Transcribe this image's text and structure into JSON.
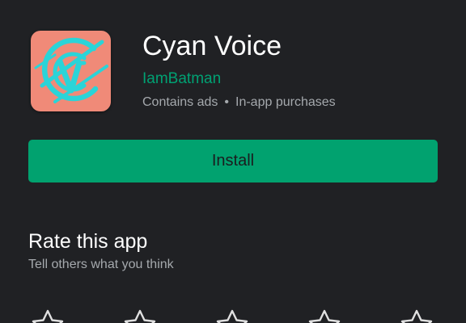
{
  "app": {
    "title": "Cyan Voice",
    "developer": "IamBatman",
    "meta_ads": "Contains ads",
    "meta_separator": "•",
    "meta_purchases": "In-app purchases",
    "icon": {
      "name": "cyan-voice-logo-icon",
      "background_color": "#f08a78",
      "foreground_color": "#2ad4d8",
      "letter": "V"
    }
  },
  "actions": {
    "install_label": "Install",
    "install_color": "#01a26f"
  },
  "rating": {
    "heading": "Rate this app",
    "subtitle": "Tell others what you think",
    "star_count": 5,
    "star_icon": "star-outline-icon"
  },
  "colors": {
    "background": "#202124",
    "accent": "#00a173",
    "secondary_text": "#a5a9ad"
  }
}
